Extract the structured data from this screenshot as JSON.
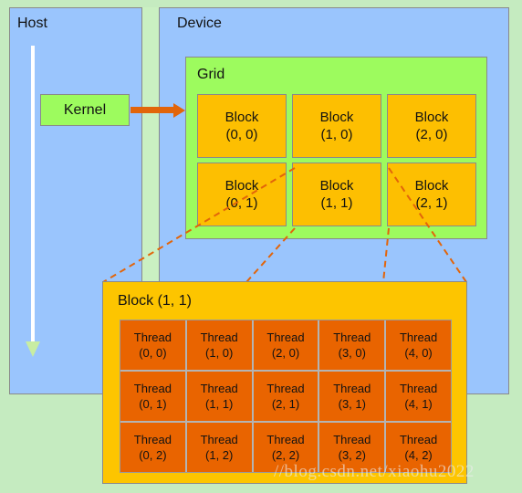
{
  "page": {
    "background_color": "#c5ebc0",
    "watermark": "//blog.csdn.net/xiaohu2022"
  },
  "host_panel": {
    "label": "Host",
    "background_color": "#9ac5fd",
    "timeline_arrow": {
      "name": "host-timeline-arrow",
      "shaft_color": "#ffffff",
      "head_color": "#c8eda2"
    },
    "kernel_box": {
      "label": "Kernel",
      "background_color": "#9dfb5e"
    }
  },
  "divider": {
    "color": "#caf0c2"
  },
  "device_panel": {
    "label": "Device",
    "background_color": "#9ac5fd",
    "launch_arrow_color": "#e2650a",
    "grid": {
      "label": "Grid",
      "background_color": "#9dfb5e",
      "block_color": "#fdbf01",
      "blocks": [
        {
          "title": "Block",
          "coords": "(0, 0)"
        },
        {
          "title": "Block",
          "coords": "(1, 0)"
        },
        {
          "title": "Block",
          "coords": "(2, 0)"
        },
        {
          "title": "Block",
          "coords": "(0, 1)"
        },
        {
          "title": "Block",
          "coords": "(1, 1)"
        },
        {
          "title": "Block",
          "coords": "(2, 1)"
        }
      ]
    }
  },
  "block_detail": {
    "title": "Block (1, 1)",
    "background_color": "#fdc500",
    "thread_color": "#e96400",
    "connector_color": "#e2650a",
    "threads": [
      {
        "title": "Thread",
        "coords": "(0, 0)"
      },
      {
        "title": "Thread",
        "coords": "(1, 0)"
      },
      {
        "title": "Thread",
        "coords": "(2, 0)"
      },
      {
        "title": "Thread",
        "coords": "(3, 0)"
      },
      {
        "title": "Thread",
        "coords": "(4, 0)"
      },
      {
        "title": "Thread",
        "coords": "(0, 1)"
      },
      {
        "title": "Thread",
        "coords": "(1, 1)"
      },
      {
        "title": "Thread",
        "coords": "(2, 1)"
      },
      {
        "title": "Thread",
        "coords": "(3, 1)"
      },
      {
        "title": "Thread",
        "coords": "(4, 1)"
      },
      {
        "title": "Thread",
        "coords": "(0, 2)"
      },
      {
        "title": "Thread",
        "coords": "(1, 2)"
      },
      {
        "title": "Thread",
        "coords": "(2, 2)"
      },
      {
        "title": "Thread",
        "coords": "(3, 2)"
      },
      {
        "title": "Thread",
        "coords": "(4, 2)"
      }
    ]
  }
}
